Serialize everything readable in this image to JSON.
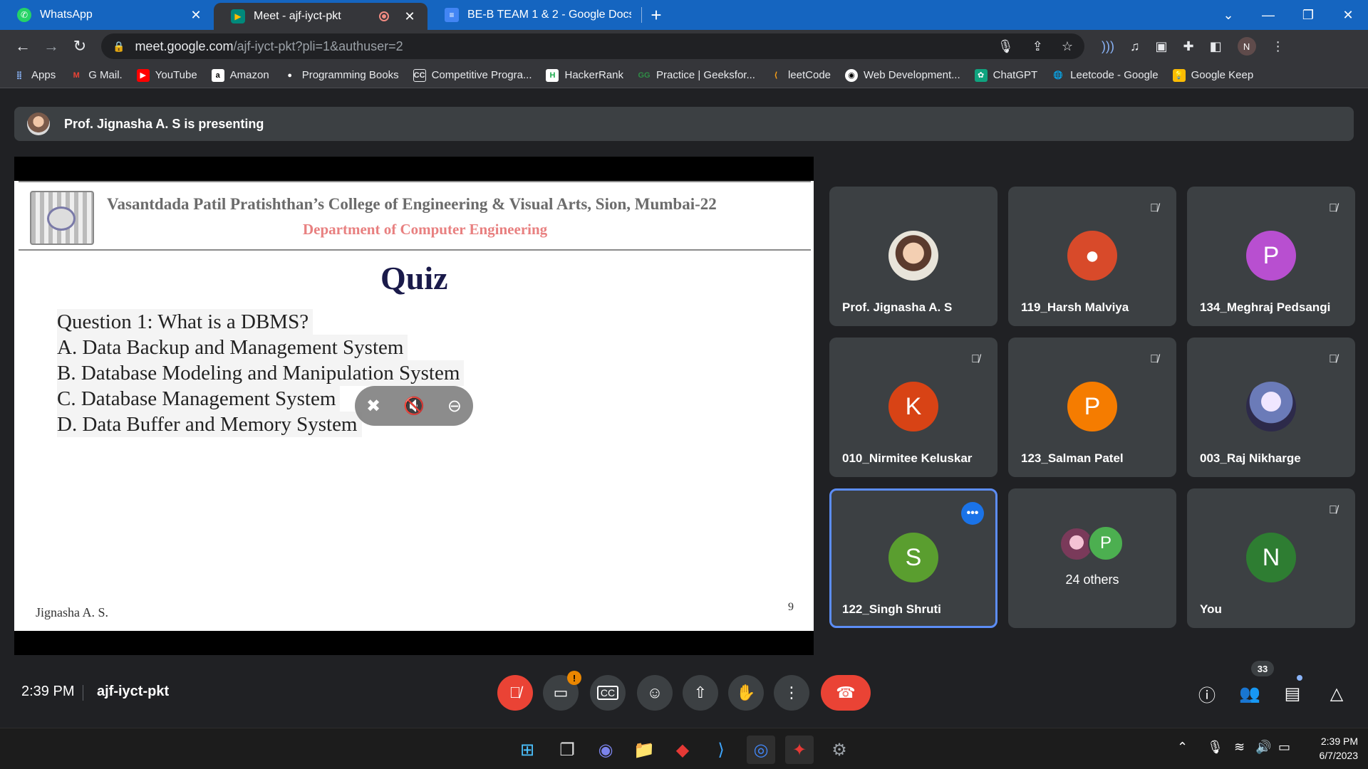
{
  "browser": {
    "tabs": [
      {
        "title": "WhatsApp",
        "icon": "whatsapp-icon",
        "color": "#25d366",
        "active": false
      },
      {
        "title": "Meet - ajf-iyct-pkt",
        "icon": "google-meet-icon",
        "color": "#00897b",
        "active": true
      },
      {
        "title": "BE-B TEAM 1 & 2 - Google Docs",
        "icon": "google-docs-icon",
        "color": "#4285f4",
        "active": false
      }
    ],
    "url_host": "meet.google.com",
    "url_path": "/ajf-iyct-pkt?pli=1&authuser=2",
    "profile_initial": "N",
    "bookmarks": [
      {
        "label": "Apps",
        "icon": "apps-grid-icon"
      },
      {
        "label": "G Mail.",
        "icon": "gmail-icon"
      },
      {
        "label": "YouTube",
        "icon": "youtube-icon"
      },
      {
        "label": "Amazon",
        "icon": "amazon-icon"
      },
      {
        "label": "Programming Books",
        "icon": "github-icon"
      },
      {
        "label": "Competitive Progra...",
        "icon": "cc-icon"
      },
      {
        "label": "HackerRank",
        "icon": "hackerrank-icon"
      },
      {
        "label": "Practice | Geeksfor...",
        "icon": "geeksforgeeks-icon"
      },
      {
        "label": "leetCode",
        "icon": "leetcode-icon"
      },
      {
        "label": "Web Development...",
        "icon": "web-dev-icon"
      },
      {
        "label": "ChatGPT",
        "icon": "chatgpt-icon"
      },
      {
        "label": "Leetcode - Google",
        "icon": "globe-icon"
      },
      {
        "label": "Google Keep",
        "icon": "google-keep-icon"
      }
    ]
  },
  "meet": {
    "presenting_text": "Prof. Jignasha A. S is presenting",
    "slide": {
      "college": "Vasantdada Patil Pratishthan’s College of Engineering  & Visual Arts, Sion, Mumbai-22",
      "department": "Department of Computer Engineering",
      "title": "Quiz",
      "lines": [
        "Question 1: What is a DBMS?",
        "A. Data Backup and Management System",
        "B. Database Modeling and Manipulation System",
        "C. Database Management System",
        "D. Data Buffer and Memory System"
      ],
      "author": "Jignasha A. S.",
      "page_number": "9"
    },
    "participants": [
      {
        "name": "Prof. Jignasha A. S",
        "initial": "",
        "color": "#c9a27e",
        "muted": false
      },
      {
        "name": "119_Harsh Malviya",
        "initial": "",
        "color": "#d84a2a",
        "muted": true
      },
      {
        "name": "134_Meghraj Pedsangi",
        "initial": "P",
        "color": "#b84fd0",
        "muted": true
      },
      {
        "name": "010_Nirmitee Keluskar",
        "initial": "K",
        "color": "#d84315",
        "muted": true
      },
      {
        "name": "123_Salman Patel",
        "initial": "P",
        "color": "#f57c00",
        "muted": true
      },
      {
        "name": "003_Raj Nikharge",
        "initial": "",
        "color": "#6b7bb8",
        "muted": true
      },
      {
        "name": "122_Singh Shruti",
        "initial": "S",
        "color": "#5a9e2f",
        "muted": false
      },
      {
        "name": "You",
        "initial": "N",
        "color": "#2e7d32",
        "muted": true
      }
    ],
    "others": {
      "label": "24 others",
      "initial": "P",
      "color": "#4caf50"
    },
    "time": "2:39 PM",
    "meeting_code": "ajf-iyct-pkt",
    "participant_count": "33"
  },
  "taskbar": {
    "time": "2:39 PM",
    "date": "6/7/2023"
  }
}
